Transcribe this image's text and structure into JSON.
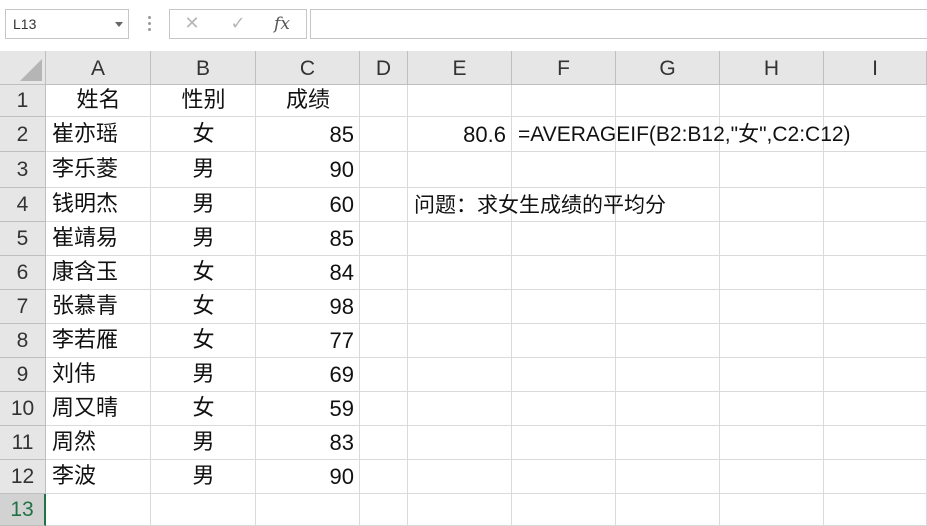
{
  "formula_bar": {
    "name_box": "L13",
    "cancel_icon": "close-icon",
    "enter_icon": "check-icon",
    "fx_label": "fx",
    "formula": ""
  },
  "columns": [
    "A",
    "B",
    "C",
    "D",
    "E",
    "F",
    "G",
    "H",
    "I"
  ],
  "rows": [
    "1",
    "2",
    "3",
    "4",
    "5",
    "6",
    "7",
    "8",
    "9",
    "10",
    "11",
    "12",
    "13"
  ],
  "selected_row": "13",
  "table": {
    "headers": [
      "姓名",
      "性别",
      "成绩"
    ],
    "records": [
      {
        "name": "崔亦瑶",
        "gender": "女",
        "score": "85"
      },
      {
        "name": "李乐菱",
        "gender": "男",
        "score": "90"
      },
      {
        "name": "钱明杰",
        "gender": "男",
        "score": "60"
      },
      {
        "name": "崔靖易",
        "gender": "男",
        "score": "85"
      },
      {
        "name": "康含玉",
        "gender": "女",
        "score": "84"
      },
      {
        "name": "张慕青",
        "gender": "女",
        "score": "98"
      },
      {
        "name": "李若雁",
        "gender": "女",
        "score": "77"
      },
      {
        "name": "刘伟",
        "gender": "男",
        "score": "69"
      },
      {
        "name": "周又晴",
        "gender": "女",
        "score": "59"
      },
      {
        "name": "周然",
        "gender": "男",
        "score": "83"
      },
      {
        "name": "李波",
        "gender": "男",
        "score": "90"
      }
    ]
  },
  "result": {
    "value": "80.6",
    "formula_text": "=AVERAGEIF(B2:B12,\"女\",C2:C12)"
  },
  "question": "问题：求女生成绩的平均分",
  "colors": {
    "accent": "#217346",
    "header_bg": "#e6e6e6",
    "gridline": "#dadada"
  }
}
